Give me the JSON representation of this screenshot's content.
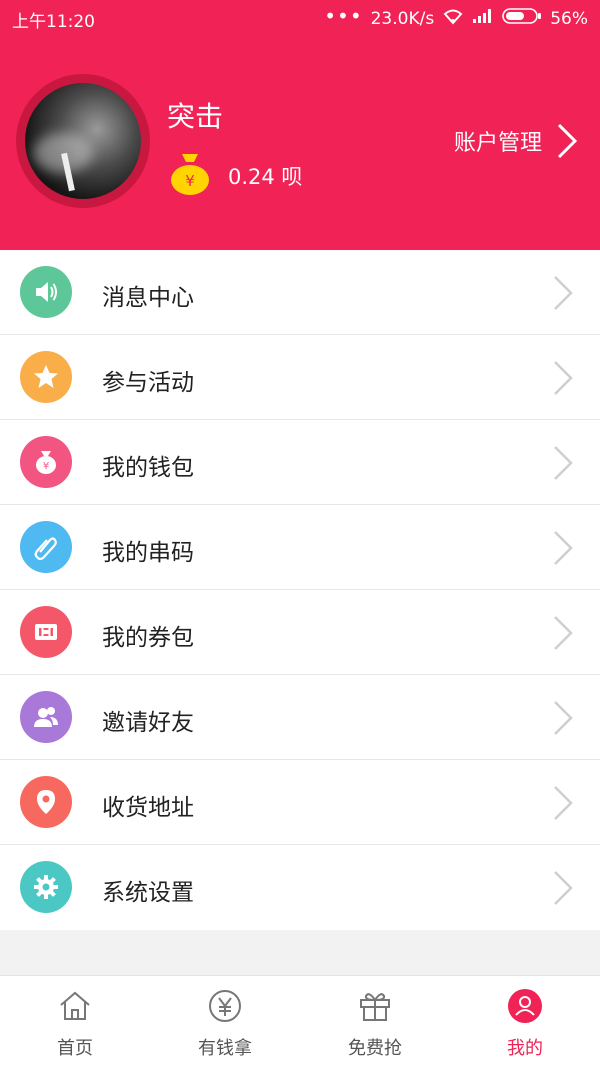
{
  "status_bar": {
    "time": "上午11:20",
    "network_speed": "23.0K/s",
    "battery": "56%"
  },
  "profile": {
    "username": "突击",
    "balance": "0.24 呗",
    "account_link": "账户管理"
  },
  "menu": {
    "items": [
      {
        "label": "消息中心",
        "icon": "speaker-icon",
        "color": "#5ec79a"
      },
      {
        "label": "参与活动",
        "icon": "star-icon",
        "color": "#f9ae4a"
      },
      {
        "label": "我的钱包",
        "icon": "wallet-bag-icon",
        "color": "#f35583"
      },
      {
        "label": "我的串码",
        "icon": "paperclip-icon",
        "color": "#4fb9f2"
      },
      {
        "label": "我的券包",
        "icon": "ticket-icon",
        "color": "#f5576a"
      },
      {
        "label": "邀请好友",
        "icon": "friends-icon",
        "color": "#a879d8"
      },
      {
        "label": "收货地址",
        "icon": "location-pin-icon",
        "color": "#f7695f"
      },
      {
        "label": "系统设置",
        "icon": "gear-icon",
        "color": "#4cc8c4"
      }
    ]
  },
  "tabbar": {
    "tabs": [
      {
        "label": "首页",
        "icon": "home-icon",
        "active": false
      },
      {
        "label": "有钱拿",
        "icon": "yen-coin-icon",
        "active": false
      },
      {
        "label": "免费抢",
        "icon": "gift-icon",
        "active": false
      },
      {
        "label": "我的",
        "icon": "profile-icon",
        "active": true
      }
    ]
  },
  "colors": {
    "brand": "#f02256",
    "chevron": "#cfcfcf"
  }
}
